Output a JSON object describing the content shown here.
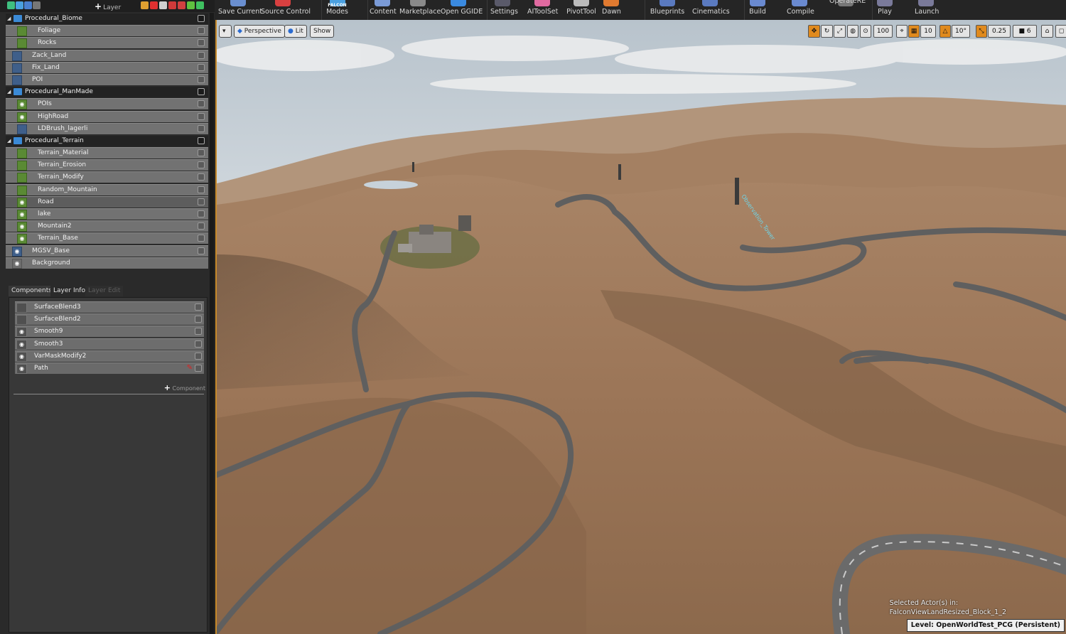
{
  "left_toolbar": {
    "icons": [
      "tree-icon",
      "refresh-icon",
      "copy-icon",
      "history-icon",
      "paint-icon",
      "bug-icon",
      "globe-icon",
      "camera-icon",
      "plant-icon",
      "grass-icon",
      "grid-icon"
    ],
    "add_layer_label": "Layer"
  },
  "layers": [
    {
      "name": "Procedural_Biome",
      "type": "group",
      "indent": 0,
      "visible": true
    },
    {
      "name": "Foliage",
      "type": "layer",
      "indent": 2,
      "visible": false,
      "color": "green"
    },
    {
      "name": "Rocks",
      "type": "layer",
      "indent": 2,
      "visible": false,
      "color": "green"
    },
    {
      "name": "Zack_Land",
      "type": "layer",
      "indent": 1,
      "visible": false,
      "color": "blue"
    },
    {
      "name": "Fix_Land",
      "type": "layer",
      "indent": 1,
      "visible": false,
      "color": "blue"
    },
    {
      "name": "POI",
      "type": "layer",
      "indent": 1,
      "visible": false,
      "color": "blue"
    },
    {
      "name": "Procedural_ManMade",
      "type": "group",
      "indent": 0,
      "visible": true
    },
    {
      "name": "POIs",
      "type": "layer",
      "indent": 2,
      "visible": true,
      "color": "green"
    },
    {
      "name": "HighRoad",
      "type": "layer",
      "indent": 2,
      "visible": true,
      "color": "green"
    },
    {
      "name": "LDBrush_lagerli",
      "type": "layer",
      "indent": 2,
      "visible": false,
      "color": "blue"
    },
    {
      "name": "Procedural_Terrain",
      "type": "group",
      "indent": 0,
      "visible": true
    },
    {
      "name": "Terrain_Material",
      "type": "layer",
      "indent": 2,
      "visible": false,
      "color": "green"
    },
    {
      "name": "Terrain_Erosion",
      "type": "layer",
      "indent": 2,
      "visible": false,
      "color": "green"
    },
    {
      "name": "Terrain_Modify",
      "type": "layer",
      "indent": 2,
      "visible": false,
      "color": "green"
    },
    {
      "name": "Random_Mountain",
      "type": "layer",
      "indent": 2,
      "visible": false,
      "color": "green"
    },
    {
      "name": "Road",
      "type": "layer",
      "indent": 2,
      "visible": true,
      "color": "green",
      "selected": true
    },
    {
      "name": "lake",
      "type": "layer",
      "indent": 2,
      "visible": true,
      "color": "green"
    },
    {
      "name": "Mountain2",
      "type": "layer",
      "indent": 2,
      "visible": true,
      "color": "green"
    },
    {
      "name": "Terrain_Base",
      "type": "layer",
      "indent": 2,
      "visible": true,
      "color": "green"
    },
    {
      "name": "MGSV_Base",
      "type": "layer",
      "indent": 1,
      "visible": true,
      "color": "blue"
    },
    {
      "name": "Background",
      "type": "layer",
      "indent": 1,
      "visible": true,
      "color": "gray"
    }
  ],
  "component_tabs": [
    {
      "label": "Components",
      "active": true
    },
    {
      "label": "Layer Info",
      "active": false
    },
    {
      "label": "Layer Edit",
      "active": false,
      "disabled": true
    }
  ],
  "components": [
    {
      "name": "SurfaceBlend3",
      "visible": false
    },
    {
      "name": "SurfaceBlend2",
      "visible": false
    },
    {
      "name": "Smooth9",
      "visible": true
    },
    {
      "name": "Smooth3",
      "visible": true
    },
    {
      "name": "VarMaskModify2",
      "visible": true
    },
    {
      "name": "Path",
      "visible": true,
      "selected": true,
      "warning": true
    }
  ],
  "add_component_label": "Component",
  "toolbar": {
    "items": [
      {
        "label": "Save Current",
        "icon": "save-icon",
        "color": "#6a8fd0"
      },
      {
        "label": "Source Control",
        "icon": "source-control-icon",
        "color": "#d84040"
      },
      {
        "label": "Modes",
        "sublabel": "FALCON",
        "icon": "modes-icon",
        "color": "#4aa0e0"
      },
      {
        "label": "Content",
        "icon": "content-icon",
        "color": "#7a9ad6"
      },
      {
        "label": "Marketplace",
        "icon": "marketplace-icon",
        "color": "#8a8a8a"
      },
      {
        "label": "Open GGIDE",
        "icon": "ggide-icon",
        "color": "#3a8ae0"
      },
      {
        "label": "Settings",
        "icon": "settings-icon",
        "color": "#5a5a6a"
      },
      {
        "label": "AIToolSet",
        "icon": "ai-toolset-icon",
        "color": "#e06aa0"
      },
      {
        "label": "PivotTool",
        "icon": "pivot-tool-icon",
        "color": "#bbbbbb"
      },
      {
        "label": "Dawn",
        "icon": "dawn-icon",
        "color": "#e07a30"
      },
      {
        "label": "Blueprints",
        "icon": "blueprints-icon",
        "color": "#5a7ac0"
      },
      {
        "label": "Cinematics",
        "icon": "cinematics-icon",
        "color": "#5a7ac0"
      },
      {
        "label": "Build",
        "icon": "build-icon",
        "color": "#6a8ad0"
      },
      {
        "label": "Compile",
        "icon": "compile-icon",
        "color": "#6a8ad0"
      },
      {
        "label": "OperateRE",
        "icon": "operate-icon",
        "color": "#777"
      },
      {
        "label": "Play",
        "icon": "play-icon",
        "color": "#7a7a9a"
      },
      {
        "label": "Launch",
        "icon": "launch-icon",
        "color": "#7a7a9a"
      }
    ]
  },
  "viewport": {
    "view_mode": "Perspective",
    "lighting": "Lit",
    "show": "Show",
    "grid_snap": "100",
    "rotation_snap": "10",
    "angle_snap": "10°",
    "scale_snap": "0.25",
    "camera_speed": "6",
    "selected_info_line1": "Selected Actor(s) in:",
    "selected_info_line2": "FalconViewLandResized_Block_1_2",
    "level_label": "Level:",
    "level_name": "OpenWorldTest_PCG (Persistent)",
    "labels": [
      "Observation_Tower"
    ],
    "colors": {
      "accent": "#c78a2a",
      "sky": "#cfd8de",
      "terrain": "#9a7656",
      "road": "#5f5f5f"
    }
  }
}
